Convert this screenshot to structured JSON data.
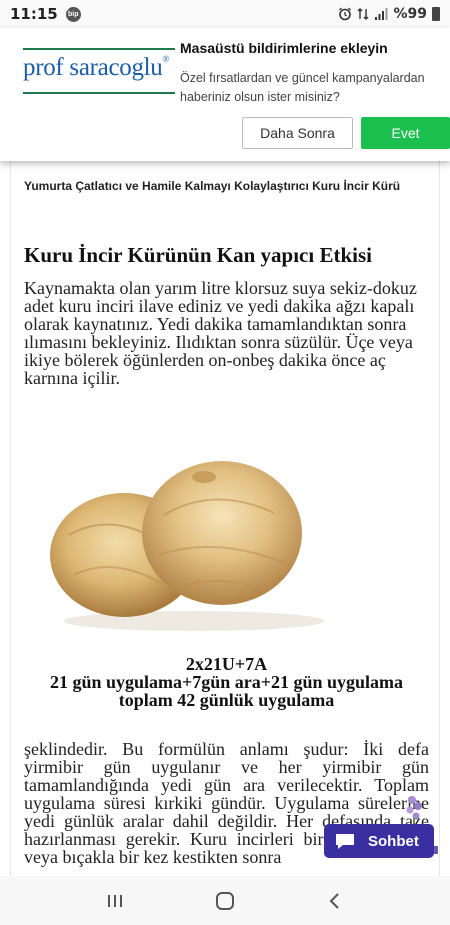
{
  "status_bar": {
    "time": "11:15",
    "badge": "bip",
    "battery_percent": "%99",
    "icons": [
      "alarm-icon",
      "data-signal-icon",
      "cell-signal-icon",
      "battery-icon"
    ]
  },
  "prompt": {
    "logo_text": "prof saracoglu",
    "logo_mark": "®",
    "title": "Masaüstü bildirimlerine ekleyin",
    "text": "Özel fırsatlardan ve güncel kampanyalardan haberiniz olsun ister misiniz?",
    "later_button": "Daha Sonra",
    "yes_button": "Evet",
    "colors": {
      "accent_green": "#1bbf4e",
      "logo_blue": "#1a5ea8",
      "logo_line": "#1e7a4a"
    }
  },
  "article": {
    "breadcrumb": "Yumurta Çatlatıcı ve Hamile Kalmayı Kolaylaştırıcı Kuru İncir Kürü",
    "heading": "Kuru İncir Kürünün Kan yapıcı Etkisi",
    "paragraph1": "Kaynamakta olan yarım litre klorsuz suya sekiz-dokuz adet kuru inciri ilave ediniz ve yedi dakika ağzı kapalı olarak kaynatınız. Yedi dakika tamamlandıktan sonra ılımasını bekleyiniz. Ilıdıktan sonra süzülür. Üçe veya ikiye bölerek öğünlerden on-onbeş dakika önce aç karnına içilir.",
    "image": "dried-figs-photo",
    "formula_lines": [
      "2x21U+7A",
      "21 gün uygulama+7gün ara+21 gün uygulama",
      "toplam 42 günlük uygulama"
    ],
    "paragraph2": "şeklindedir. Bu formülün anlamı şudur: İki defa yirmibir gün uygulanır ve her yirmibir gün tamamlandığında yedi gün ara verilecektir. Toplam uygulama süresi kırkiki gündür. Uygulama sürelerine yedi günlük aralar dahil değildir. Her defasında taze hazırlanması gerekir. Kuru incirleri bir kere koparıp veya bıçakla bir kez kestikten sonra"
  },
  "chat": {
    "label": "Sohbet",
    "color": "#3a2fa0"
  },
  "nav_bar": {
    "buttons": [
      "recent-apps-icon",
      "home-icon",
      "back-icon"
    ]
  }
}
